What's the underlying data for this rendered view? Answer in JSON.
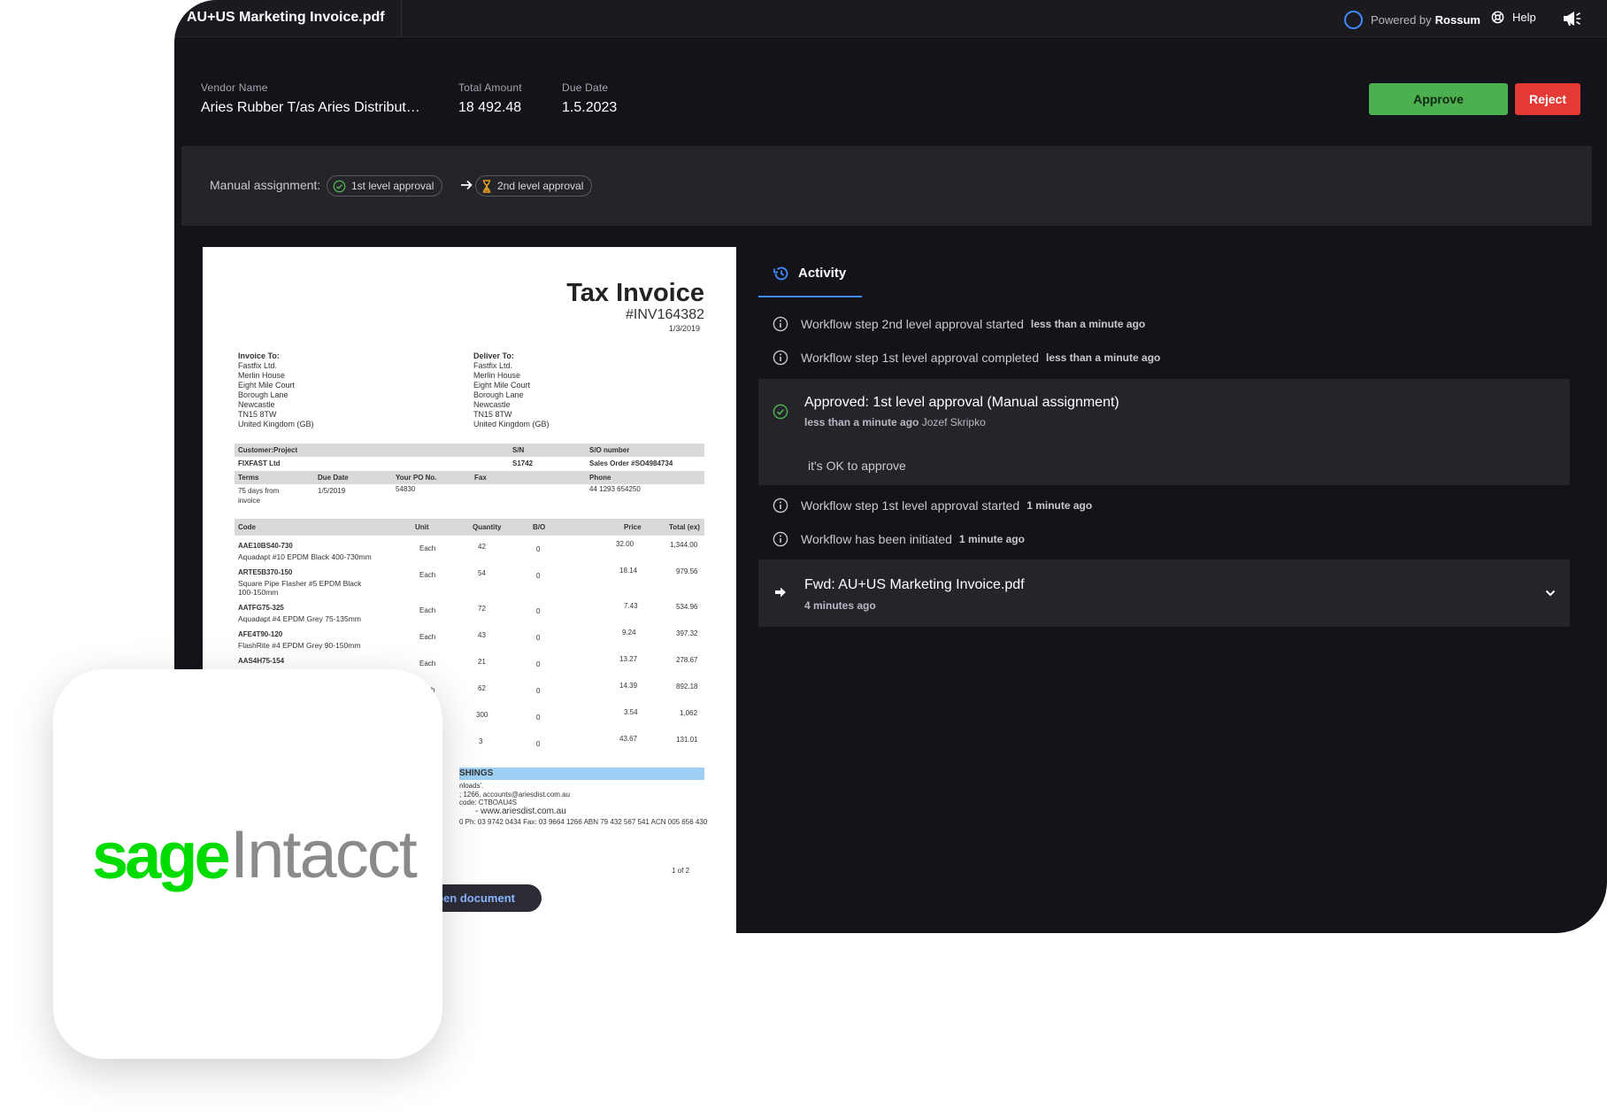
{
  "window": {
    "title": "AU+US Marketing Invoice.pdf"
  },
  "topbar": {
    "powered_by": "Powered by",
    "powered_brand": "Rossum",
    "help": "Help"
  },
  "summary": [
    {
      "label": "Vendor Name",
      "value": "Aries Rubber T/as Aries Distribut…"
    },
    {
      "label": "Total Amount",
      "value": "18 492.48"
    },
    {
      "label": "Due Date",
      "value": "1.5.2023"
    }
  ],
  "actions": {
    "approve": "Approve",
    "reject": "Reject"
  },
  "assignment": {
    "label": "Manual assignment:",
    "steps": [
      "1st level approval",
      "2nd level approval"
    ]
  },
  "invoice": {
    "title": "Tax Invoice",
    "number": "#INV164382",
    "date": "1/3/2019",
    "invoice_to": {
      "label": "Invoice To:",
      "lines": [
        "Fastfix Ltd.",
        "Merlin House",
        "Eight Mile Court",
        "Borough Lane",
        "Newcastle",
        "TN15 8TW",
        "United Kingdom (GB)"
      ]
    },
    "deliver_to": {
      "label": "Deliver To:",
      "lines": [
        "Fastfix Ltd.",
        "Merlin House",
        "Eight Mile Court",
        "Borough Lane",
        "Newcastle",
        "TN15 8TW",
        "United Kingdom (GB)"
      ]
    },
    "meta_headers": [
      "Customer:Project",
      "S/N",
      "S/O number"
    ],
    "meta_values": [
      "FIXFAST Ltd",
      "S1742",
      "Sales Order #SO4984734"
    ],
    "terms_headers": [
      "Terms",
      "Due Date",
      "Your PO No.",
      "Fax",
      "Phone"
    ],
    "terms_values": [
      "75   days   from",
      "1/5/2019",
      "54830",
      "",
      "44 1293 654250"
    ],
    "terms_extra": "invoice",
    "line_headers": [
      "Code",
      "Unit",
      "Quantity",
      "B/O",
      "Price",
      "Total (ex)"
    ],
    "lines": [
      {
        "code": "AAE10BS40-730",
        "desc": "Aquadapt #10 EPDM Black 400-730mm",
        "unit": "Each",
        "qty": "42",
        "bo": "0",
        "price": "32.00",
        "total": "1,344.00"
      },
      {
        "code": "ARTE5B370-150",
        "desc": "Square  Pipe  Flasher  #5  EPDM  Black",
        "desc2": "100-150mm",
        "unit": "Each",
        "qty": "54",
        "bo": "0",
        "price": "18.14",
        "total": "979.56"
      },
      {
        "code": "AATFG75-325",
        "desc": "Aquadapt #4 EPDM Grey 75-135mm",
        "unit": "Each",
        "qty": "72",
        "bo": "0",
        "price": "7.43",
        "total": "534.96"
      },
      {
        "code": "AFE4T90-120",
        "desc": "FlashRite #4 EPDM Grey 90-150mm",
        "unit": "Each",
        "qty": "43",
        "bo": "0",
        "price": "9.24",
        "total": "397.32"
      },
      {
        "code": "AAS4H75-154",
        "desc": "",
        "unit": "Each",
        "qty": "21",
        "bo": "0",
        "price": "13.27",
        "total": "278.67"
      },
      {
        "code": "",
        "desc": "",
        "unit": "h",
        "qty": "62",
        "bo": "0",
        "price": "14.39",
        "total": "892.18"
      },
      {
        "code": "",
        "desc": "",
        "unit": "",
        "qty": "300",
        "bo": "0",
        "price": "3.54",
        "total": "1,062"
      },
      {
        "code": "",
        "desc": "",
        "unit": "",
        "qty": "3",
        "bo": "0",
        "price": "43.67",
        "total": "131.01"
      }
    ],
    "footer_heading": "SHINGS",
    "footer_lines": [
      "nloads'.",
      "; 1266, accounts@ariesdist.com.au",
      "code: CTBOAU4S",
      "- www.ariesdist.com.au",
      "0  Ph: 03 9742 0434  Fax: 03 9664 1266  ABN 79 432 567 541  ACN 005 656 430"
    ],
    "page": "1 of 2",
    "open_button": "Open document"
  },
  "activity": {
    "tab": "Activity",
    "items": [
      {
        "text": "Workflow step 2nd level approval started",
        "when": "less than a minute ago"
      },
      {
        "text": "Workflow step 1st level approval completed",
        "when": "less than a minute ago"
      }
    ],
    "approved_card": {
      "title": "Approved: 1st level approval (Manual assignment)",
      "when": "less than a minute ago",
      "who": "Jozef Skripko",
      "comment": "it's OK to approve"
    },
    "items2": [
      {
        "text": "Workflow step 1st level approval started",
        "when": "1 minute ago"
      },
      {
        "text": "Workflow has been initiated",
        "when": "1 minute ago"
      }
    ],
    "fwd_card": {
      "title": "Fwd: AU+US Marketing Invoice.pdf",
      "when": "4 minutes ago"
    }
  },
  "logo": {
    "brand": "sage",
    "product": "Intacct"
  },
  "colors": {
    "approve": "#4caf50",
    "reject": "#e53935",
    "accent": "#3d8bff",
    "sage_green": "#00dc00"
  }
}
